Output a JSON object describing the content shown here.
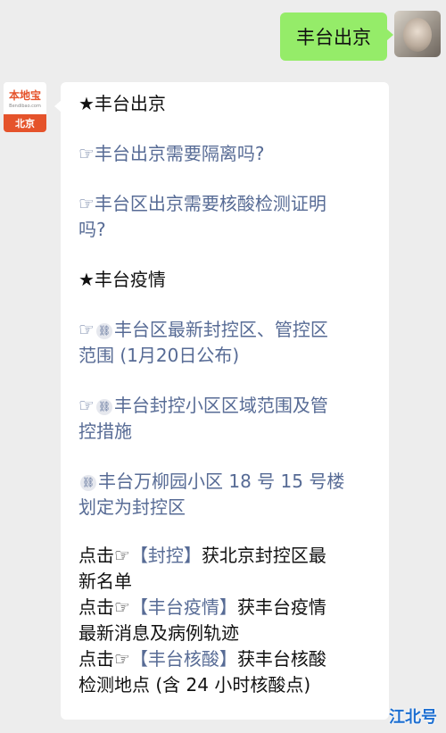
{
  "outgoing": {
    "text": "丰台出京"
  },
  "bot_avatar": {
    "logo": "本地宝",
    "domain": "Bendibao.com",
    "city": "北京"
  },
  "reply": {
    "section1": "★丰台出京",
    "q1": "☞丰台出京需要隔离吗?",
    "q2_l1": "☞丰台区出京需要核酸检测证明",
    "q2_l2": "吗?",
    "section2": "★丰台疫情",
    "a1_l1": "丰台区最新封控区、管控区",
    "a1_l2": "范围 (1月20日公布)",
    "a2_l1": "丰台封控小区区域范围及管",
    "a2_l2": "控措施",
    "a3_l1": "丰台万柳园小区 18 号 15 号楼",
    "a3_l2": "划定为封控区",
    "k1_pre": "点击☞",
    "k1_key": "【封控】",
    "k1_post": "获北京封控区最",
    "k1_l2": "新名单",
    "k2_pre": "点击☞",
    "k2_key": "【丰台疫情】",
    "k2_post": "获丰台疫情",
    "k2_l2": "最新消息及病例轨迹",
    "k3_pre": "点击☞",
    "k3_key": "【丰台核酸】",
    "k3_post": "获丰台核酸",
    "k3_l2": "检测地点 (含 24 小时核酸点)",
    "pointer": "☞"
  },
  "watermark": "江北号",
  "colors": {
    "link": "#576b95",
    "bubble_out": "#95ec69",
    "background": "#ededed"
  }
}
